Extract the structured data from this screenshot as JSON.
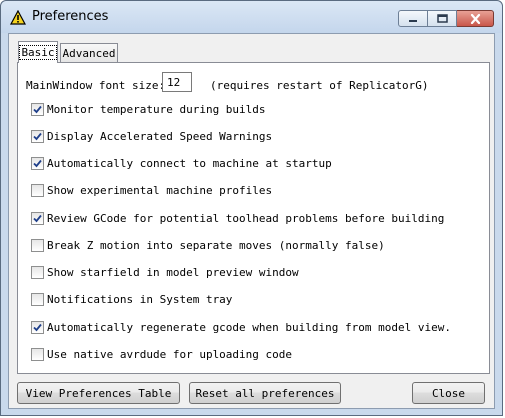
{
  "window": {
    "title": "Preferences",
    "icon": "warning-triangle-icon"
  },
  "tabs": [
    {
      "label": "Basic",
      "selected": true
    },
    {
      "label": "Advanced",
      "selected": false
    }
  ],
  "font_size": {
    "label": "MainWindow font size:",
    "value": "12",
    "note": "(requires restart of ReplicatorG)"
  },
  "options": [
    {
      "label": "Monitor temperature during builds",
      "checked": true
    },
    {
      "label": "Display Accelerated Speed Warnings",
      "checked": true
    },
    {
      "label": "Automatically connect to machine at startup",
      "checked": true
    },
    {
      "label": "Show experimental machine profiles",
      "checked": false
    },
    {
      "label": "Review GCode for potential toolhead problems before building",
      "checked": true
    },
    {
      "label": "Break Z motion into separate moves (normally false)",
      "checked": false
    },
    {
      "label": "Show starfield in model preview window",
      "checked": false
    },
    {
      "label": "Notifications in System tray",
      "checked": false
    },
    {
      "label": "Automatically regenerate gcode when building from model view.",
      "checked": true
    },
    {
      "label": "Use native avrdude for uploading code",
      "checked": false
    }
  ],
  "buttons": {
    "view_table": "View Preferences Table",
    "reset_all": "Reset all preferences",
    "close": "Close"
  }
}
